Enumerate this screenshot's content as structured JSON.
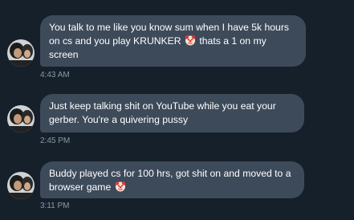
{
  "colors": {
    "background": "#16202b",
    "bubble": "#3d4a5a",
    "text": "#ffffff",
    "timestamp": "#8899a6"
  },
  "messages": [
    {
      "text_before": "You talk to me like you know sum when I have 5k hours on cs and you play KRUNKER",
      "emoji": "clown-face-icon",
      "text_after": " thats a 1 on my screen",
      "time": "4:43 AM"
    },
    {
      "text_before": "Just keep talking shit on YouTube while you eat your gerber. You're a quivering pussy",
      "emoji": null,
      "text_after": "",
      "time": "2:45 PM"
    },
    {
      "text_before": "Buddy played cs for 100 hrs, got shit on and moved to a browser game",
      "emoji": "clown-face-icon",
      "text_after": "",
      "time": "3:11 PM"
    }
  ]
}
